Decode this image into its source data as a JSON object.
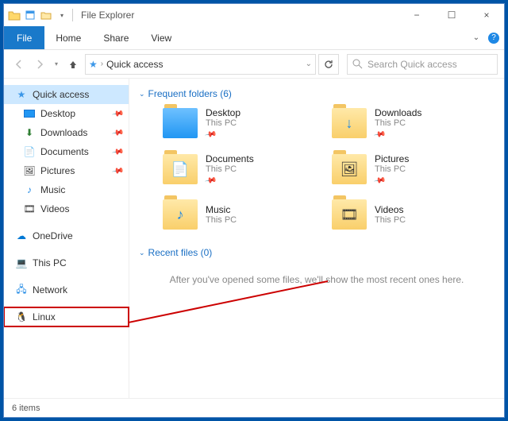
{
  "window": {
    "title": "File Explorer",
    "controls": {
      "min": "−",
      "max": "☐",
      "close": "×"
    }
  },
  "ribbon": {
    "file": "File",
    "tabs": [
      "Home",
      "Share",
      "View"
    ]
  },
  "nav": {
    "breadcrumb": "Quick access",
    "search_placeholder": "Search Quick access"
  },
  "sidebar": {
    "quick_access": "Quick access",
    "items": [
      {
        "label": "Desktop",
        "pinned": true
      },
      {
        "label": "Downloads",
        "pinned": true
      },
      {
        "label": "Documents",
        "pinned": true
      },
      {
        "label": "Pictures",
        "pinned": true
      },
      {
        "label": "Music",
        "pinned": false
      },
      {
        "label": "Videos",
        "pinned": false
      }
    ],
    "onedrive": "OneDrive",
    "this_pc": "This PC",
    "network": "Network",
    "linux": "Linux"
  },
  "content": {
    "frequent_header": "Frequent folders (6)",
    "folders": [
      {
        "name": "Desktop",
        "sub": "This PC",
        "pinned": true,
        "glyph": ""
      },
      {
        "name": "Downloads",
        "sub": "This PC",
        "pinned": true,
        "glyph": "↓"
      },
      {
        "name": "Documents",
        "sub": "This PC",
        "pinned": true,
        "glyph": "📄"
      },
      {
        "name": "Pictures",
        "sub": "This PC",
        "pinned": true,
        "glyph": "🖼"
      },
      {
        "name": "Music",
        "sub": "This PC",
        "pinned": false,
        "glyph": "♪"
      },
      {
        "name": "Videos",
        "sub": "This PC",
        "pinned": false,
        "glyph": "🎞"
      }
    ],
    "recent_header": "Recent files (0)",
    "empty": "After you've opened some files, we'll show the most recent ones here."
  },
  "status": {
    "text": "6 items"
  }
}
